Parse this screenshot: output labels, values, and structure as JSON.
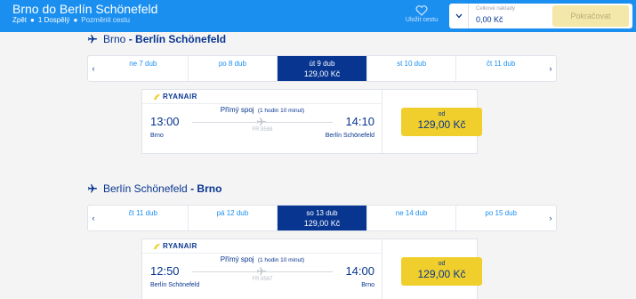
{
  "header": {
    "title": "Brno do Berlín Schönefeld",
    "back": "Zpět",
    "passengers": "1 Dospělý",
    "change": "Pozměnit cestu",
    "save": "Uložit cestu",
    "total_label": "Celkové náklady",
    "total_amount": "0,00 Kč",
    "continue": "Pokračovat"
  },
  "outbound": {
    "from": "Brno",
    "dash": " - ",
    "to": "Berlín Schönefeld",
    "dates": [
      {
        "label": "ne 7 dub"
      },
      {
        "label": "po 8 dub"
      },
      {
        "label": "út 9 dub",
        "price": "129,00 Kč"
      },
      {
        "label": "st 10 dub"
      },
      {
        "label": "čt 11 dub"
      }
    ],
    "flight": {
      "airline": "RYANAIR",
      "dep_time": "13:00",
      "arr_time": "14:10",
      "dep_city": "Brno",
      "arr_city": "Berlín Schönefeld",
      "direct": "Přímý spoj",
      "duration": "(1 hodin 10 minut)",
      "flight_no": "FR 8568",
      "from_label": "od",
      "price": "129,00 Kč"
    }
  },
  "return": {
    "from": "Berlín Schönefeld",
    "dash": " - ",
    "to": "Brno",
    "dates": [
      {
        "label": "čt 11 dub"
      },
      {
        "label": "pá 12 dub"
      },
      {
        "label": "so 13 dub",
        "price": "129,00 Kč"
      },
      {
        "label": "ne 14 dub"
      },
      {
        "label": "po 15 dub"
      }
    ],
    "flight": {
      "airline": "RYANAIR",
      "dep_time": "12:50",
      "arr_time": "14:00",
      "dep_city": "Berlín Schönefeld",
      "arr_city": "Brno",
      "direct": "Přímý spoj",
      "duration": "(1 hodin 10 minut)",
      "flight_no": "FR 8567",
      "from_label": "od",
      "price": "129,00 Kč"
    }
  },
  "icons": {
    "plane": "plane-icon",
    "heart": "heart-icon",
    "chevron_left": "chevron-left-icon",
    "chevron_right": "chevron-right-icon",
    "chevron_down": "chevron-down-icon",
    "logo": "ryanair-harp-logo"
  },
  "colors": {
    "header_bg": "#1a8ff0",
    "brand_navy": "#073590",
    "price_yellow": "#f0cf2c",
    "continue_disabled": "#f3e8a9"
  }
}
